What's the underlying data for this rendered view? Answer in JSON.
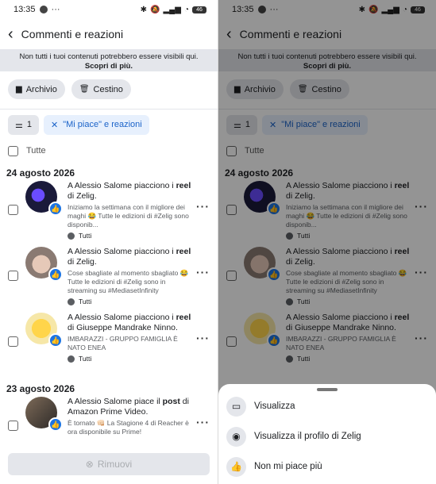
{
  "status": {
    "time": "13:35",
    "battery": "46"
  },
  "header": {
    "title": "Commenti e reazioni"
  },
  "notice": {
    "text": "Non tutti i tuoi contenuti potrebbero essere visibili qui.",
    "link": "Scopri di più."
  },
  "chips": {
    "archive": "Archivio",
    "trash": "Cestino"
  },
  "filters": {
    "count": "1",
    "active": "\"Mi piace\" e reazioni"
  },
  "select_all": "Tutte",
  "groups": [
    {
      "date": "24 agosto 2026",
      "items": [
        {
          "pre": "A Alessio Salome piacciono i ",
          "kind": "reel",
          "post": " di Zelig.",
          "snippet": "Iniziamo la settimana con il migliore dei maghi 😂 Tutte le edizioni di #Zelig sono disponib...",
          "audience": "Tutti"
        },
        {
          "pre": "A Alessio Salome piacciono i ",
          "kind": "reel",
          "post": " di Zelig.",
          "snippet": "Cose sbagliate al momento sbagliato 😂 Tutte le edizioni di #Zelig sono in streaming su #MediasetInfinity",
          "audience": "Tutti"
        },
        {
          "pre": "A Alessio Salome piacciono i ",
          "kind": "reel",
          "post": " di Giuseppe Mandrake Ninno.",
          "snippet": "IMBARAZZI - GRUPPO FAMIGLIA È NATO ENEA",
          "audience": "Tutti"
        }
      ]
    },
    {
      "date": "23 agosto 2026",
      "items": [
        {
          "pre": "A Alessio Salome piace il ",
          "kind": "post",
          "post": " di Amazon Prime Video.",
          "snippet": "È tornato 👊🏻 La Stagione 4 di Reacher è ora disponibile su Prime!",
          "audience": ""
        }
      ]
    }
  ],
  "remove_label": "Rimuovi",
  "sheet": {
    "items": [
      {
        "label": "Visualizza",
        "icon": "view-icon"
      },
      {
        "label": "Visualizza il profilo di Zelig",
        "icon": "profile-icon"
      },
      {
        "label": "Non mi piace più",
        "icon": "thumbs-up-icon"
      }
    ]
  },
  "colors": {
    "accent": "#1b74e4",
    "active_filter_bg": "#e7f0fd",
    "chip_bg": "#e4e6eb"
  }
}
